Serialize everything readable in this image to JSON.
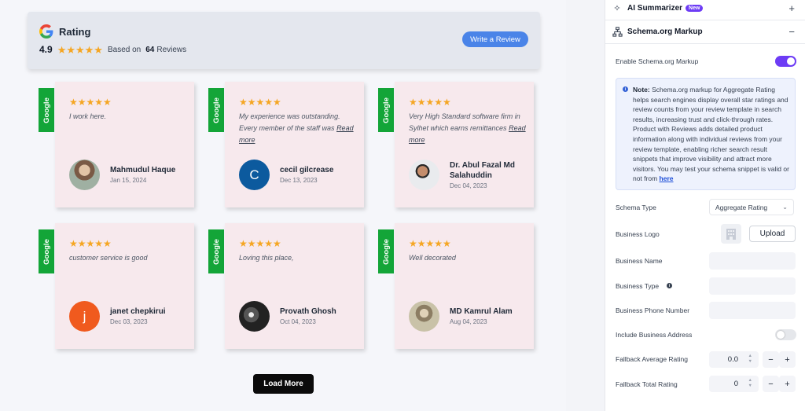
{
  "preview": {
    "header": {
      "title": "Rating",
      "average": "4.9",
      "stars": "★★★★★",
      "based_on_prefix": "Based on",
      "review_count": "64",
      "based_on_suffix": "Reviews",
      "write_review_label": "Write a Review",
      "average_rating_value": 4.9
    },
    "badge_label": "Google",
    "reviews": [
      {
        "stars": "★★★★★",
        "text": "I work here.",
        "read_more": "",
        "name": "Mahmudul Haque",
        "date": "Jan 15, 2024",
        "avatar_letter": ""
      },
      {
        "stars": "★★★★★",
        "text": "My experience was outstanding. Every member of the staff was",
        "read_more": "Read more",
        "name": "cecil gilcrease",
        "date": "Dec 13, 2023",
        "avatar_letter": "C"
      },
      {
        "stars": "★★★★★",
        "text": "Very High Standard software firm in Sylhet which earns remittances",
        "read_more": "Read more",
        "name": "Dr. Abul Fazal Md Salahuddin",
        "date": "Dec 04, 2023",
        "avatar_letter": ""
      },
      {
        "stars": "★★★★★",
        "text": "customer service is good",
        "read_more": "",
        "name": "janet chepkirui",
        "date": "Dec 03, 2023",
        "avatar_letter": "j"
      },
      {
        "stars": "★★★★★",
        "text": "Loving this place,",
        "read_more": "",
        "name": "Provath Ghosh",
        "date": "Oct 04, 2023",
        "avatar_letter": ""
      },
      {
        "stars": "★★★★★",
        "text": "Well decorated",
        "read_more": "",
        "name": "MD Kamrul Alam",
        "date": "Aug 04, 2023",
        "avatar_letter": ""
      }
    ],
    "load_more_label": "Load More"
  },
  "panel": {
    "ai_summarizer": {
      "title": "AI Summarizer",
      "badge": "New",
      "toggle": "+"
    },
    "schema": {
      "title": "Schema.org Markup",
      "toggle": "−"
    },
    "enable_label": "Enable Schema.org Markup",
    "enable_on": true,
    "note": {
      "lead": "Note:",
      "body": " Schema.org markup for Aggregate Rating helps search engines display overall star ratings and review counts from your review template in search results, increasing trust and click-through rates. Product with Reviews adds detailed product information along with individual reviews from your review template, enabling richer search result snippets that improve visibility and attract more visitors. You may test your schema snippet is valid or not from ",
      "link": "here"
    },
    "schema_type_label": "Schema Type",
    "schema_type_value": "Aggregate Rating",
    "business_logo_label": "Business Logo",
    "upload_label": "Upload",
    "business_name_label": "Business Name",
    "business_type_label": "Business Type",
    "business_phone_label": "Business Phone Number",
    "include_address_label": "Include Business Address",
    "include_address_on": false,
    "fallback_avg_label": "Fallback Average Rating",
    "fallback_avg_value": "0.0",
    "fallback_total_label": "Fallback Total Rating",
    "fallback_total_value": "0",
    "minus": "−",
    "plus": "+",
    "colors": {
      "accent": "#6d3cf5",
      "google_green": "#13a538",
      "star": "#f5a623",
      "write_btn": "#4a84e8"
    }
  }
}
